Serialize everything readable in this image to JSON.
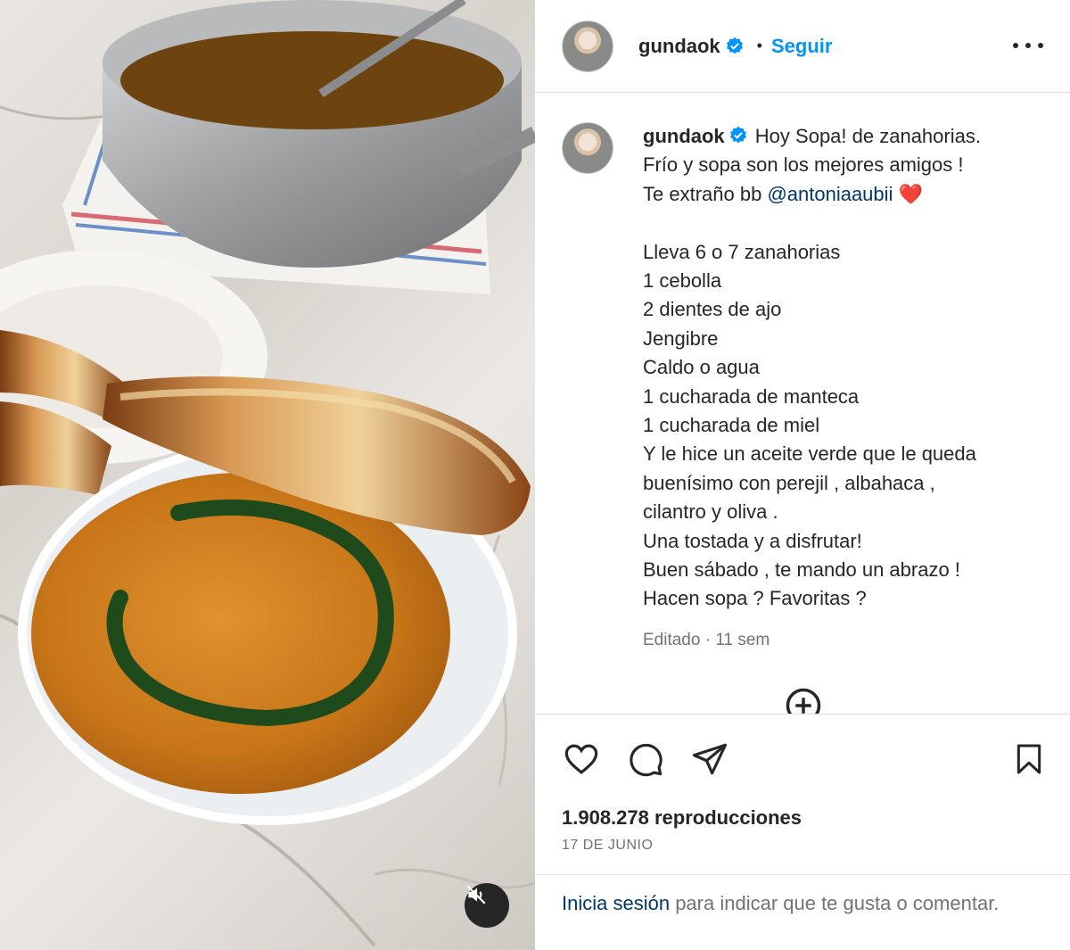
{
  "post": {
    "username": "gundaok",
    "follow_label": "Seguir",
    "separator": "•",
    "caption_lines": [
      "Hoy Sopa! de zanahorias.",
      "Frío y sopa son los mejores amigos !",
      "Te extraño bb",
      "Lleva 6 o 7 zanahorias",
      "1 cebolla",
      "2 dientes de ajo",
      "Jengibre",
      "Caldo o agua",
      "1 cucharada de manteca",
      "1 cucharada de miel",
      "Y le hice un aceite verde que le queda",
      "buenísimo con perejil , albahaca ,",
      "cilantro y oliva .",
      "Una tostada y a disfrutar!",
      "Buen sábado , te mando un abrazo !",
      "Hacen sopa ? Favoritas ?"
    ],
    "mention": "@antoniaaubii",
    "heart_emoji": "❤️",
    "meta": "Editado · 11 sem",
    "views": "1.908.278 reproducciones",
    "date": "17 DE JUNIO",
    "login_link": "Inicia sesión",
    "login_rest": " para indicar que te gusta o comentar."
  },
  "icons": {
    "verified": "verified-badge-icon",
    "more": "more-options-icon",
    "load_more": "plus-circle-icon",
    "like": "heart-icon",
    "comment": "comment-icon",
    "share": "paper-plane-icon",
    "save": "bookmark-icon",
    "mute": "speaker-muted-icon"
  },
  "colors": {
    "accent": "#0095f6",
    "verified": "#0095f6",
    "link": "#00376b",
    "muted_text": "#737373",
    "text": "#262626"
  }
}
